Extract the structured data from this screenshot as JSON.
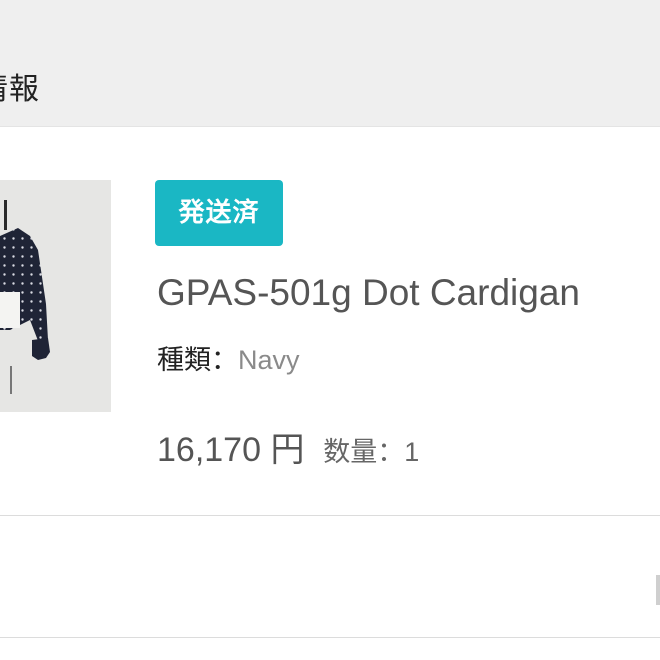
{
  "section": {
    "title": "情報"
  },
  "order_item": {
    "status_badge": "発送済",
    "product_name": "GPAS-501g Dot Cardigan",
    "variant_label": "種類：",
    "variant_value": "Navy",
    "price": "16,170 円",
    "quantity_label": "数量：",
    "quantity_value": "1",
    "image_icon": "cardigan-product-photo"
  },
  "colors": {
    "badge": "#1ab7c4",
    "header_bg": "#efefef",
    "cardigan": "#1f2436"
  }
}
